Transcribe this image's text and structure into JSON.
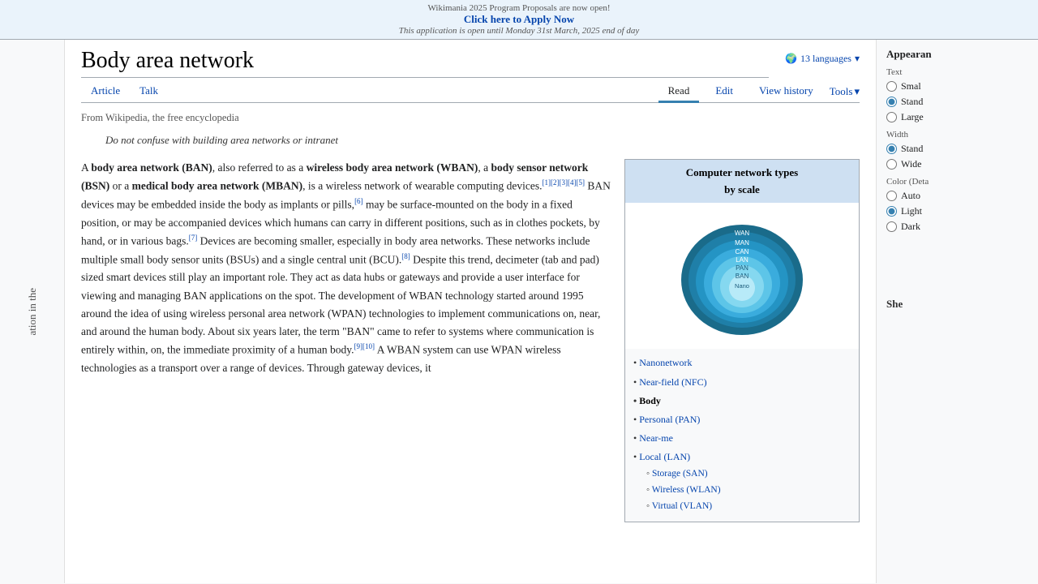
{
  "banner": {
    "line1": "Wikimania 2025 Program Proposals are now open!",
    "cta": "Click here to Apply Now",
    "line2": "This application is open until Monday 31st March, 2025 end of day"
  },
  "header": {
    "title": "Body area network",
    "languages_label": "13 languages",
    "tabs_left": [
      {
        "label": "Article",
        "active": false
      },
      {
        "label": "Talk",
        "active": false
      }
    ],
    "tabs_right": [
      {
        "label": "Read",
        "active": true
      },
      {
        "label": "Edit"
      },
      {
        "label": "View history"
      },
      {
        "label": "Tools"
      }
    ]
  },
  "article": {
    "from_wiki": "From Wikipedia, the free encyclopedia",
    "hatnote": "Do not confuse with building area networks or intranet",
    "body_paragraphs": [
      "A body area network (BAN), also referred to as a wireless body area network (WBAN), a body sensor network (BSN) or a medical body area network (MBAN), is a wireless network of wearable computing devices. BAN devices may be embedded inside the body as implants or pills, may be surface-mounted on the body in a fixed position, or may be accompanied devices which humans can carry in different positions, such as in clothes pockets, by hand, or in various bags. Devices are becoming smaller, especially in body area networks. These networks include multiple small body sensor units (BSUs) and a single central unit (BCU). Despite this trend, decimeter (tab and pad) sized smart devices still play an important role. They act as data hubs or gateways and provide a user interface for viewing and managing BAN applications on the spot. The development of WBAN technology started around 1995 around the idea of using wireless personal area network (WPAN) technologies to implement communications on, near, and around the human body. About six years later, the term \"BAN\" came to refer to systems where communication is entirely within, on, the immediate proximity of a human body. A WBAN system can use WPAN wireless technologies as a transport over a range of devices. Through gateway devices, it"
    ]
  },
  "infobox": {
    "title": "Computer network types",
    "subtitle": "by scale",
    "list_items": [
      {
        "label": "Nanonetwork",
        "bold": false
      },
      {
        "label": "Near-field (NFC)",
        "bold": false
      },
      {
        "label": "Body",
        "bold": true
      },
      {
        "label": "Personal (PAN)",
        "bold": false
      },
      {
        "label": "Near-me",
        "bold": false
      },
      {
        "label": "Local (LAN)",
        "bold": false
      }
    ],
    "sub_items": [
      {
        "label": "Storage (SAN)"
      },
      {
        "label": "Wireless (WLAN)"
      },
      {
        "label": "Virtual (VLAN)"
      }
    ],
    "layers": [
      {
        "label": "WAN",
        "color": "#1a6b8a",
        "r": 75
      },
      {
        "label": "MAN",
        "color": "#1f7fa8",
        "r": 65
      },
      {
        "label": "CAN",
        "color": "#2494c4",
        "r": 55
      },
      {
        "label": "LAN",
        "color": "#29a8de",
        "r": 45
      },
      {
        "label": "PAN",
        "color": "#4dbde8",
        "r": 35
      },
      {
        "label": "BAN",
        "color": "#72d2f0",
        "r": 26
      },
      {
        "label": "Nano",
        "color": "#a8e4f8",
        "r": 17
      }
    ]
  },
  "sidebar_left": {
    "text": "ation in the"
  },
  "right_panel": {
    "title": "Appearan",
    "text_section": "Text",
    "text_options": [
      {
        "label": "Smal",
        "selected": false
      },
      {
        "label": "Stand",
        "selected": true
      },
      {
        "label": "Large",
        "selected": false
      }
    ],
    "width_section": "Width",
    "width_options": [
      {
        "label": "Stand",
        "selected": true
      },
      {
        "label": "Wide",
        "selected": false
      }
    ],
    "color_section": "Color (Deta",
    "color_options": [
      {
        "label": "Auto",
        "selected": false
      },
      {
        "label": "Light",
        "selected": true
      },
      {
        "label": "Dark",
        "selected": false
      }
    ],
    "partial_text": "She"
  }
}
